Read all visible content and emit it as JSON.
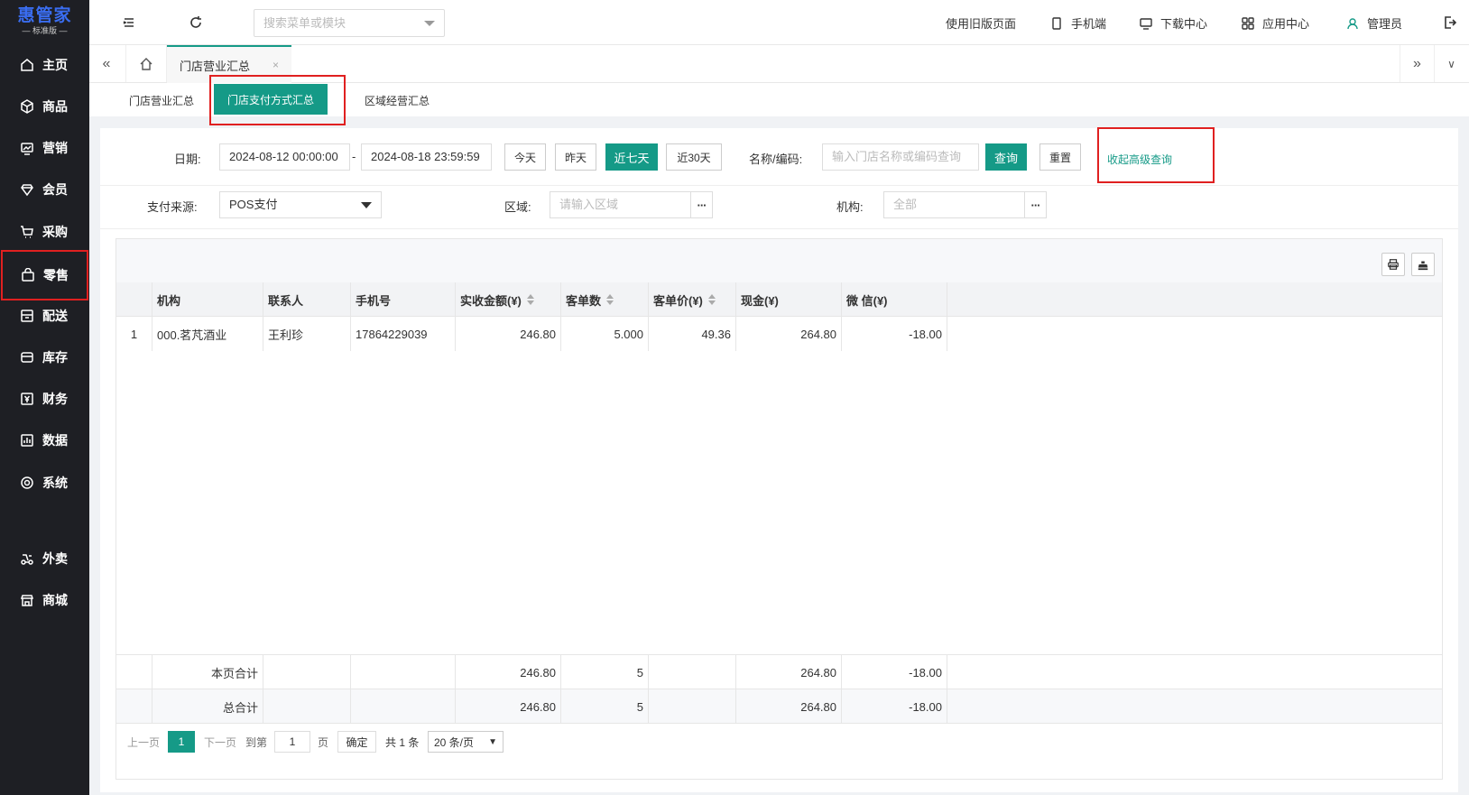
{
  "app": {
    "logo": "惠管家",
    "edition": "— 标准版 —"
  },
  "sidebar": {
    "items": [
      {
        "label": "主页",
        "icon": "home-icon"
      },
      {
        "label": "商品",
        "icon": "box-icon"
      },
      {
        "label": "营销",
        "icon": "chart-icon"
      },
      {
        "label": "会员",
        "icon": "diamond-icon"
      },
      {
        "label": "采购",
        "icon": "cart-icon"
      },
      {
        "label": "零售",
        "icon": "bag-icon"
      },
      {
        "label": "配送",
        "icon": "truck-icon"
      },
      {
        "label": "库存",
        "icon": "inventory-icon"
      },
      {
        "label": "财务",
        "icon": "yen-icon"
      },
      {
        "label": "数据",
        "icon": "data-icon"
      },
      {
        "label": "系统",
        "icon": "settings-icon"
      },
      {
        "label": "外卖",
        "icon": "takeout-icon"
      },
      {
        "label": "商城",
        "icon": "store-icon"
      }
    ]
  },
  "topbar": {
    "search_placeholder": "搜索菜单或模块",
    "old_page": "使用旧版页面",
    "mobile": "手机端",
    "download": "下载中心",
    "apps": "应用中心",
    "user": "管理员"
  },
  "tabs": {
    "active": "门店营业汇总",
    "close": "×"
  },
  "subtabs": [
    "门店营业汇总",
    "门店支付方式汇总",
    "区域经营汇总"
  ],
  "filters": {
    "date_label": "日期:",
    "date_start": "2024-08-12 00:00:00",
    "date_sep": "-",
    "date_end": "2024-08-18 23:59:59",
    "quick": [
      "今天",
      "昨天",
      "近七天",
      "近30天"
    ],
    "name_label": "名称/编码:",
    "name_placeholder": "输入门店名称或编码查询",
    "query": "查询",
    "reset": "重置",
    "collapse": "收起高级查询",
    "pay_label": "支付来源:",
    "pay_value": "POS支付",
    "region_label": "区域:",
    "region_placeholder": "请输入区域",
    "org_label": "机构:",
    "org_placeholder": "全部",
    "more": "···"
  },
  "table": {
    "headers": [
      "机构",
      "联系人",
      "手机号",
      "实收金额(¥)",
      "客单数",
      "客单价(¥)",
      "现金(¥)",
      "微 信(¥)"
    ],
    "rows": [
      [
        "1",
        "000.茗芃酒业",
        "王利珍",
        "17864229039",
        "246.80",
        "5.000",
        "49.36",
        "264.80",
        "-18.00"
      ]
    ],
    "page_total": {
      "label": "本页合计",
      "amount": "246.80",
      "count": "5",
      "cash": "264.80",
      "wechat": "-18.00"
    },
    "grand_total": {
      "label": "总合计",
      "amount": "246.80",
      "count": "5",
      "cash": "264.80",
      "wechat": "-18.00"
    }
  },
  "pager": {
    "prev": "上一页",
    "current": "1",
    "next": "下一页",
    "goto": "到第",
    "page_input": "1",
    "page_unit": "页",
    "confirm": "确定",
    "total": "共 1 条",
    "page_size": "20 条/页"
  }
}
